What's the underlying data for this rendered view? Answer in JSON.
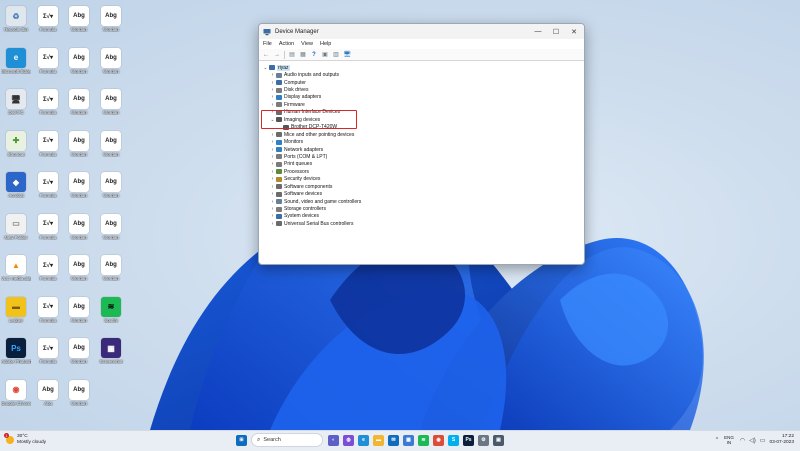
{
  "desktop": {
    "icons": [
      {
        "label": "Recycle Bin",
        "glyph": "♻",
        "col": 0,
        "row": 0,
        "bg": "#dfe6ee",
        "fg": "#4a7fb5"
      },
      {
        "label": "Microsoft Edge",
        "glyph": "e",
        "col": 0,
        "row": 1,
        "bg": "#1f8fd6",
        "fg": "#ffffff"
      },
      {
        "label": "Dell PC",
        "glyph": "🖥",
        "col": 0,
        "row": 2,
        "bg": "#e4e9ef",
        "fg": "#333333"
      },
      {
        "label": "Shortcut",
        "glyph": "✚",
        "col": 0,
        "row": 3,
        "bg": "#e9f2e1",
        "fg": "#4d9a2d"
      },
      {
        "label": "Acrobat",
        "glyph": "◆",
        "col": 0,
        "row": 4,
        "bg": "#2b66c8",
        "fg": "#ffffff"
      },
      {
        "label": "New Folder",
        "glyph": "▭",
        "col": 0,
        "row": 5,
        "bg": "#f1f1f1",
        "fg": "#888888"
      },
      {
        "label": "VLC media player",
        "glyph": "▲",
        "col": 0,
        "row": 6,
        "bg": "#ffffff",
        "fg": "#f08a00"
      },
      {
        "label": "Ledger",
        "glyph": "▬",
        "col": 0,
        "row": 7,
        "bg": "#f2c21c",
        "fg": "#7a5a00"
      },
      {
        "label": "Adobe Photoshop",
        "glyph": "Ps",
        "col": 0,
        "row": 8,
        "bg": "#0a1f3c",
        "fg": "#31a8ff"
      },
      {
        "label": "Google Chrome",
        "glyph": "◉",
        "col": 0,
        "row": 9,
        "bg": "#ffffff",
        "fg": "#dd4b39"
      },
      {
        "label": "Formula",
        "glyph": "Σ√▾",
        "col": 1,
        "row": 0
      },
      {
        "label": "Formula",
        "glyph": "Σ√▾",
        "col": 1,
        "row": 1
      },
      {
        "label": "Formula",
        "glyph": "Σ√▾",
        "col": 1,
        "row": 2
      },
      {
        "label": "Formula",
        "glyph": "Σ√▾",
        "col": 1,
        "row": 3
      },
      {
        "label": "Formula",
        "glyph": "Σ√▾",
        "col": 1,
        "row": 4
      },
      {
        "label": "Formula",
        "glyph": "Σ√▾",
        "col": 1,
        "row": 5
      },
      {
        "label": "Formula",
        "glyph": "Σ√▾",
        "col": 1,
        "row": 6
      },
      {
        "label": "Formula",
        "glyph": "Σ√▾",
        "col": 1,
        "row": 7
      },
      {
        "label": "Formula",
        "glyph": "Σ√▾",
        "col": 1,
        "row": 8
      },
      {
        "label": "Abg",
        "glyph": "Abg",
        "col": 1,
        "row": 9
      },
      {
        "label": "Wordart",
        "glyph": "Abg",
        "col": 2,
        "row": 0
      },
      {
        "label": "Wordart",
        "glyph": "Abg",
        "col": 2,
        "row": 1
      },
      {
        "label": "Wordart",
        "glyph": "Abg",
        "col": 2,
        "row": 2
      },
      {
        "label": "Wordart",
        "glyph": "Abg",
        "col": 2,
        "row": 3
      },
      {
        "label": "Wordart",
        "glyph": "Abg",
        "col": 2,
        "row": 4
      },
      {
        "label": "Wordart",
        "glyph": "Abg",
        "col": 2,
        "row": 5
      },
      {
        "label": "Wordart",
        "glyph": "Abg",
        "col": 2,
        "row": 6
      },
      {
        "label": "Wordart",
        "glyph": "Abg",
        "col": 2,
        "row": 7
      },
      {
        "label": "Wordart",
        "glyph": "Abg",
        "col": 2,
        "row": 8
      },
      {
        "label": "Wordart",
        "glyph": "Abg",
        "col": 2,
        "row": 9
      },
      {
        "label": "Wordart",
        "glyph": "Abg",
        "col": 3,
        "row": 0
      },
      {
        "label": "Wordart",
        "glyph": "Abg",
        "col": 3,
        "row": 1
      },
      {
        "label": "Wordart",
        "glyph": "Abg",
        "col": 3,
        "row": 2
      },
      {
        "label": "Wordart",
        "glyph": "Abg",
        "col": 3,
        "row": 3
      },
      {
        "label": "Wordart",
        "glyph": "Abg",
        "col": 3,
        "row": 4
      },
      {
        "label": "Wordart",
        "glyph": "Abg",
        "col": 3,
        "row": 5
      },
      {
        "label": "Wordart",
        "glyph": "Abg",
        "col": 3,
        "row": 6
      },
      {
        "label": "Spotify",
        "glyph": "≋",
        "col": 3,
        "row": 7,
        "bg": "#1db954",
        "fg": "#000000"
      },
      {
        "label": "Screenshot",
        "glyph": "▦",
        "col": 3,
        "row": 8,
        "bg": "#3b2a7a",
        "fg": "#ffffff"
      }
    ]
  },
  "window": {
    "title": "Device Manager",
    "controls": {
      "minimize": "—",
      "maximize": "☐",
      "close": "✕"
    },
    "menu": [
      "File",
      "Action",
      "View",
      "Help"
    ],
    "toolbar": [
      "←",
      "→",
      "▤",
      "▦",
      "?",
      "▣",
      "▥",
      "🖥"
    ],
    "root": "riyaz",
    "tree": [
      {
        "label": "Audio inputs and outputs",
        "expanded": false,
        "color": "#6a7f96"
      },
      {
        "label": "Computer",
        "expanded": false,
        "color": "#3a6ea5"
      },
      {
        "label": "Disk drives",
        "expanded": false,
        "color": "#7b7b7b"
      },
      {
        "label": "Display adapters",
        "expanded": false,
        "color": "#2f7fc1"
      },
      {
        "label": "Firmware",
        "expanded": false,
        "color": "#7b7b7b"
      },
      {
        "label": "Human Interface Devices",
        "expanded": false,
        "color": "#6b6b6b"
      },
      {
        "label": "Imaging devices",
        "expanded": true,
        "color": "#555555"
      },
      {
        "label": "Brother DCP-T420W",
        "child": true,
        "color": "#555555"
      },
      {
        "label": "Mice and other pointing devices",
        "expanded": false,
        "color": "#6b6b6b"
      },
      {
        "label": "Monitors",
        "expanded": false,
        "color": "#2f7fc1"
      },
      {
        "label": "Network adapters",
        "expanded": false,
        "color": "#2f7fc1"
      },
      {
        "label": "Ports (COM & LPT)",
        "expanded": false,
        "color": "#7b7b7b"
      },
      {
        "label": "Print queues",
        "expanded": false,
        "color": "#7b7b7b"
      },
      {
        "label": "Processors",
        "expanded": false,
        "color": "#5a8a3a"
      },
      {
        "label": "Security devices",
        "expanded": false,
        "color": "#b08a2a"
      },
      {
        "label": "Software components",
        "expanded": false,
        "color": "#6b6b6b"
      },
      {
        "label": "Software devices",
        "expanded": false,
        "color": "#6b6b6b"
      },
      {
        "label": "Sound, video and game controllers",
        "expanded": false,
        "color": "#6a7f96"
      },
      {
        "label": "Storage controllers",
        "expanded": false,
        "color": "#7b7b7b"
      },
      {
        "label": "System devices",
        "expanded": false,
        "color": "#3a6ea5"
      },
      {
        "label": "Universal Serial Bus controllers",
        "expanded": false,
        "color": "#6b6b6b"
      }
    ]
  },
  "taskbar": {
    "weather_temp": "30°C",
    "weather_desc": "Mostly cloudy",
    "weather_badge": "1",
    "search_placeholder": "Search",
    "apps": [
      {
        "name": "windows-start",
        "glyph": "⊞",
        "bg": "#0f6cbd"
      },
      {
        "name": "chat",
        "glyph": "◐",
        "bg": "#5b5fc7"
      },
      {
        "name": "copilot",
        "glyph": "◍",
        "bg": "#7a4fd6"
      },
      {
        "name": "edge",
        "glyph": "e",
        "bg": "#1f8fd6"
      },
      {
        "name": "file-explorer",
        "glyph": "▬",
        "bg": "#f2b632"
      },
      {
        "name": "mail",
        "glyph": "✉",
        "bg": "#0f6cbd"
      },
      {
        "name": "store",
        "glyph": "▦",
        "bg": "#3a7bd5"
      },
      {
        "name": "spotify",
        "glyph": "≋",
        "bg": "#1db954"
      },
      {
        "name": "chrome",
        "glyph": "◉",
        "bg": "#dd4b39"
      },
      {
        "name": "skype",
        "glyph": "S",
        "bg": "#00aff0"
      },
      {
        "name": "photoshop",
        "glyph": "Ps",
        "bg": "#0a1f3c"
      },
      {
        "name": "settings",
        "glyph": "⚙",
        "bg": "#6b7785"
      },
      {
        "name": "device-manager",
        "glyph": "▣",
        "bg": "#4a5a6a"
      }
    ],
    "tray_overflow": "^",
    "lang_top": "ENG",
    "lang_bottom": "IN",
    "wifi": "◠",
    "volume": "◁)",
    "battery": "▭",
    "time": "17:22",
    "date": "03-07-2023"
  }
}
